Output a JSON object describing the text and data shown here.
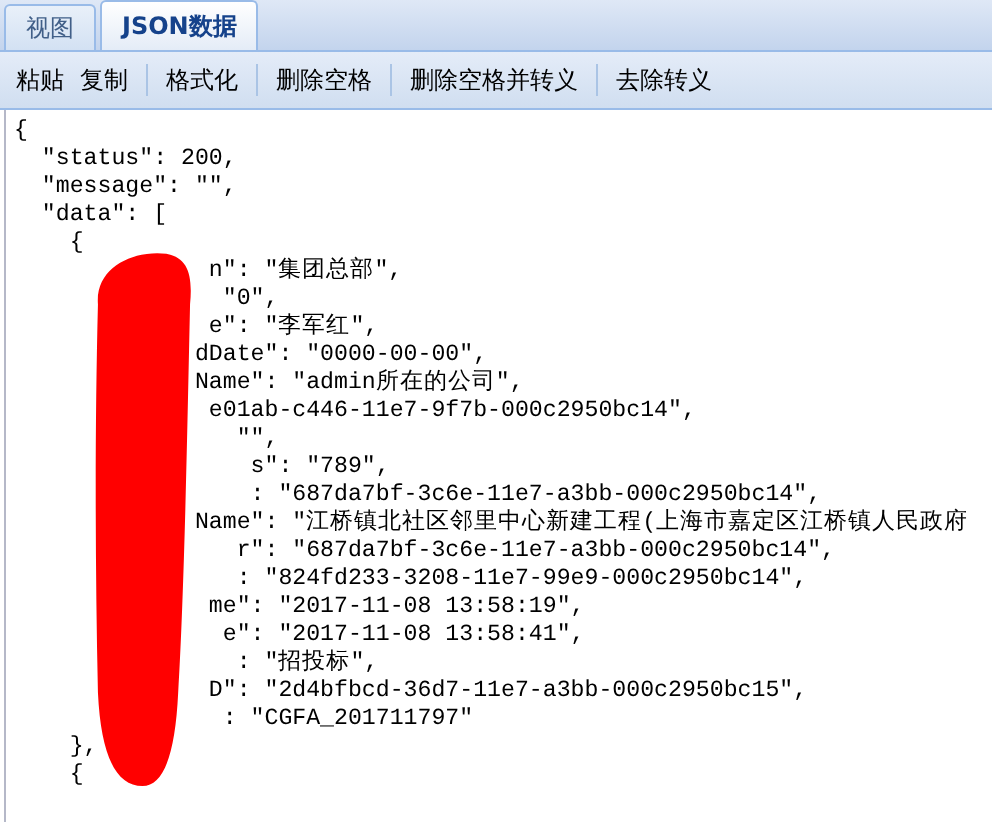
{
  "tabs": [
    {
      "label": "视图",
      "selected": false
    },
    {
      "label": "JSON数据",
      "selected": true
    }
  ],
  "toolbar": [
    {
      "kind": "button",
      "label": "粘贴"
    },
    {
      "kind": "button",
      "label": "复制"
    },
    {
      "kind": "separator"
    },
    {
      "kind": "button",
      "label": "格式化"
    },
    {
      "kind": "separator"
    },
    {
      "kind": "button",
      "label": "删除空格"
    },
    {
      "kind": "separator"
    },
    {
      "kind": "button",
      "label": "删除空格并转义"
    },
    {
      "kind": "separator"
    },
    {
      "kind": "button",
      "label": "去除转义"
    }
  ],
  "editor_lines": [
    "{",
    "  \"status\": 200,",
    "  \"message\": \"\",",
    "  \"data\": [",
    "    {",
    "              n\": \"集团总部\",",
    "               \"0\",",
    "              e\": \"李军红\",",
    "             dDate\": \"0000-00-00\",",
    "             Name\": \"admin所在的公司\",",
    "              e01ab-c446-11e7-9f7b-000c2950bc14\",",
    "                \"\",",
    "                 s\": \"789\",",
    "                 : \"687da7bf-3c6e-11e7-a3bb-000c2950bc14\",",
    "             Name\": \"江桥镇北社区邻里中心新建工程(上海市嘉定区江桥镇人民政府",
    "                r\": \"687da7bf-3c6e-11e7-a3bb-000c2950bc14\",",
    "                : \"824fd233-3208-11e7-99e9-000c2950bc14\",",
    "              me\": \"2017-11-08 13:58:19\",",
    "               e\": \"2017-11-08 13:58:41\",",
    "                : \"招投标\",",
    "              D\": \"2d4bfbcd-36d7-11e7-a3bb-000c2950bc15\",",
    "               : \"CGFA_201711797\"",
    "    },",
    "    {"
  ]
}
